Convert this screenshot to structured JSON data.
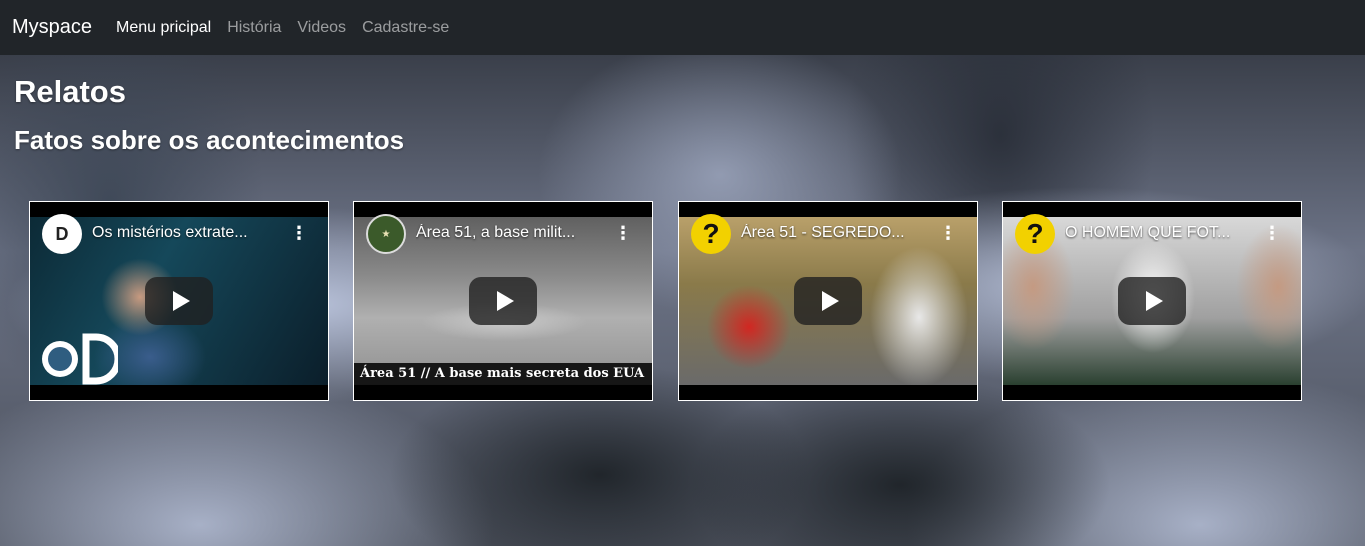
{
  "navbar": {
    "brand": "Myspace",
    "links": [
      {
        "label": "Menu pricipal",
        "active": true
      },
      {
        "label": "História",
        "active": false
      },
      {
        "label": "Videos",
        "active": false
      },
      {
        "label": "Cadastre-se",
        "active": false
      }
    ]
  },
  "main": {
    "title": "Relatos",
    "subtitle": "Fatos sobre os acontecimentos"
  },
  "videos": [
    {
      "title": "Os mistérios extrate...",
      "channel_icon": "discovery-logo-icon",
      "caption": ""
    },
    {
      "title": "Área 51, a base milit...",
      "channel_icon": "mundo-militar-logo-icon",
      "caption": "Área 51 // A base mais secreta dos EUA"
    },
    {
      "title": "Área 51 - SEGREDO...",
      "channel_icon": "question-mark-icon",
      "caption": ""
    },
    {
      "title": "O HOMEM QUE FOT...",
      "channel_icon": "question-mark-icon",
      "caption": ""
    }
  ],
  "icons": {
    "play": "play-icon",
    "more": "more-vertical-icon"
  },
  "colors": {
    "navbar_bg": "#212529",
    "nav_active": "#ffffff",
    "nav_inactive": "rgba(255,255,255,0.55)",
    "play_button_bg": "#212121"
  }
}
